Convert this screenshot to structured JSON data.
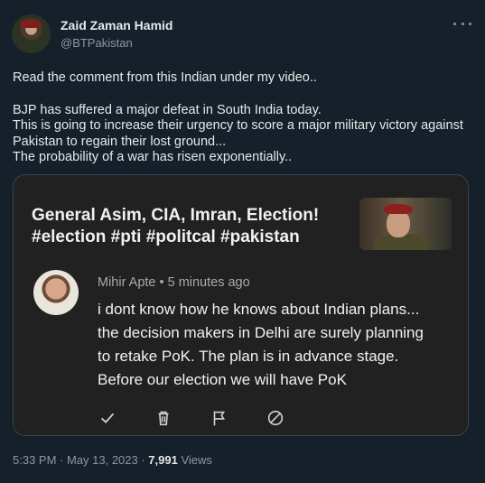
{
  "author": {
    "name": "Zaid Zaman Hamid",
    "handle": "@BTPakistan"
  },
  "tweet": {
    "line1": "Read the comment from this Indian under my video..",
    "line2": "BJP has suffered a major defeat in South India today.",
    "line3": "This is going to increase their urgency to score a major military victory against Pakistan to regain their lost ground...",
    "line4": "The probability of a war has risen exponentially.."
  },
  "media": {
    "video_title_line1": "General Asim, CIA, Imran, Election!",
    "video_title_line2": "#election #pti #politcal #pakistan",
    "comment_author": "Mihir Apte • 5 minutes ago",
    "comment_lines": [
      "i dont know how he knows about Indian plans...",
      "the decision makers in Delhi are surely planning",
      "to retake PoK. The plan is in advance stage.",
      "Before our election we will have PoK"
    ],
    "actions": [
      "check-icon",
      "trash-icon",
      "flag-icon",
      "block-icon"
    ]
  },
  "footer": {
    "timestamp": "5:33 PM · May 13, 2023 · ",
    "views_count": "7,991",
    "views_label": " Views"
  },
  "colors": {
    "background": "#15202b",
    "card": "#212121",
    "text": "#e7e9ea",
    "muted": "#8b98a5"
  }
}
